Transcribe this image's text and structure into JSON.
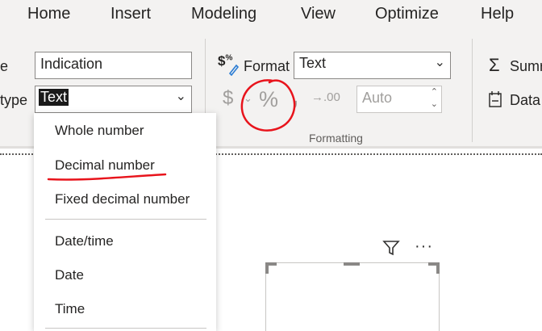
{
  "menu": {
    "items": [
      "Home",
      "Insert",
      "Modeling",
      "View",
      "Optimize",
      "Help"
    ]
  },
  "properties": {
    "name_label_fragment": "e",
    "name_value": "Indication",
    "type_label_fragment": "type",
    "type_value": "Text"
  },
  "formatting": {
    "format_label": "Format",
    "format_value": "Text",
    "currency_symbol": "$",
    "percent_symbol": "%",
    "comma_symbol": ",",
    "decimal_glyph": "→.00",
    "decimal_value": "Auto",
    "group_label": "Formatting"
  },
  "calculations": {
    "summarize_fragment": "Sumr",
    "data_fragment": "Data"
  },
  "dropdown": {
    "options": [
      "Whole number",
      "Decimal number",
      "Fixed decimal number",
      "Date/time",
      "Date",
      "Time"
    ]
  },
  "colors": {
    "annotation": "#e8141c",
    "ribbon_bg": "#f3f2f1"
  }
}
